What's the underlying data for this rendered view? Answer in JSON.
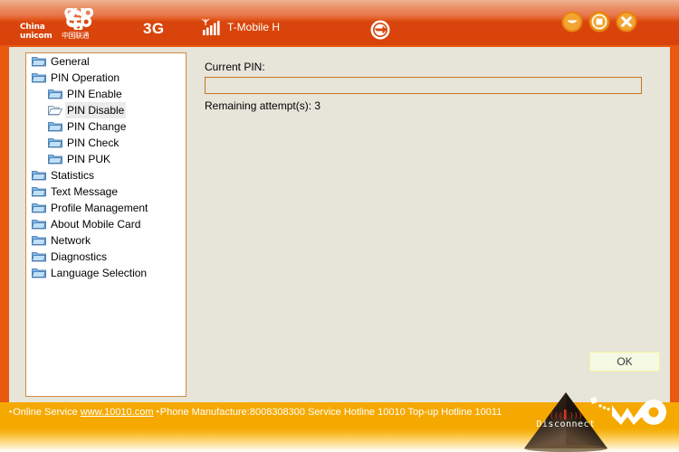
{
  "header": {
    "logo": {
      "icon": "china-unicom-knot-icon",
      "text_line1": "China",
      "text_line2": "unicom",
      "text_cn": "中国联通"
    },
    "network_mode": "3G",
    "signal_icon": "signal-bars-icon",
    "operator": "T-Mobile H",
    "connection_status_icon": "connected-circle-icon",
    "window_controls": [
      {
        "name": "minimize-button",
        "icon": "minimize-icon"
      },
      {
        "name": "maximize-button",
        "icon": "maximize-icon"
      },
      {
        "name": "close-button",
        "icon": "close-icon"
      }
    ]
  },
  "sidebar": {
    "items": [
      {
        "label": "General",
        "level": 0,
        "selected": false,
        "open": false
      },
      {
        "label": "PIN Operation",
        "level": 0,
        "selected": false,
        "open": false
      },
      {
        "label": "PIN Enable",
        "level": 1,
        "selected": false,
        "open": false
      },
      {
        "label": "PIN Disable",
        "level": 1,
        "selected": true,
        "open": true
      },
      {
        "label": "PIN Change",
        "level": 1,
        "selected": false,
        "open": false
      },
      {
        "label": "PIN Check",
        "level": 1,
        "selected": false,
        "open": false
      },
      {
        "label": "PIN PUK",
        "level": 1,
        "selected": false,
        "open": false
      },
      {
        "label": "Statistics",
        "level": 0,
        "selected": false,
        "open": false
      },
      {
        "label": "Text Message",
        "level": 0,
        "selected": false,
        "open": false
      },
      {
        "label": "Profile Management",
        "level": 0,
        "selected": false,
        "open": false
      },
      {
        "label": "About Mobile Card",
        "level": 0,
        "selected": false,
        "open": false
      },
      {
        "label": "Network",
        "level": 0,
        "selected": false,
        "open": false
      },
      {
        "label": "Diagnostics",
        "level": 0,
        "selected": false,
        "open": false
      },
      {
        "label": "Language Selection",
        "level": 0,
        "selected": false,
        "open": false
      }
    ]
  },
  "main": {
    "pin_label": "Current PIN:",
    "pin_value": "",
    "pin_placeholder": "",
    "remaining_attempts": "Remaining attempt(s): 3",
    "ok_label": "OK"
  },
  "footer": {
    "bullet": "▪",
    "segment1": "Online Service ",
    "link": "www.10010.com",
    "segment2": "Phone Manufacture:8008308300 Service Hotline 10010 Top-up Hotline 10011",
    "disconnect_label": "Disconnect",
    "disconnect_signal_icon": "signal-active-icon",
    "brand_logo": "wo-logo"
  },
  "colors": {
    "header_orange": "#d9430b",
    "frame_orange": "#e9590f",
    "panel_beige": "#e7e4da",
    "footer_gold": "#f5a900",
    "tree_border": "#d08b3d",
    "input_border": "#c4761f",
    "ok_bg": "#f6f9e4",
    "ok_border": "#f4f39a"
  }
}
